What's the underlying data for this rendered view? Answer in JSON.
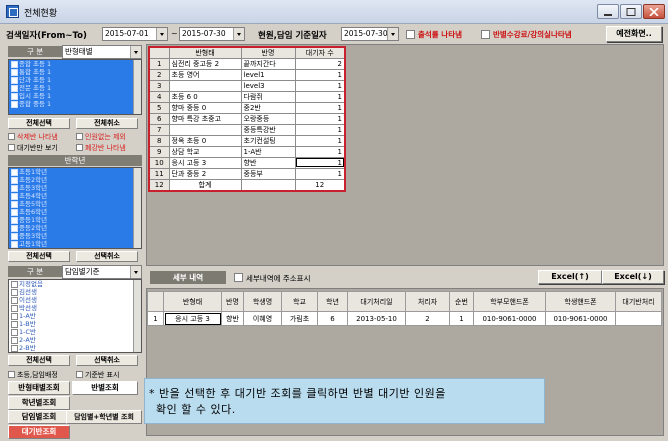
{
  "window": {
    "title": "전체현황"
  },
  "toolbar": {
    "search_date_label": "검색일자(From~To)",
    "date_from": "2015-07-01",
    "tilde": "~",
    "date_to": "2015-07-30",
    "class_base_label": "현원,담임 기준일자",
    "class_base_date": "2015-07-30",
    "chk_attendance_label": "출석률 나타냄",
    "chk_tuition_label": "반별수강료/강의실나타냄",
    "prev_screen_button": "예전화면.."
  },
  "left_panel": {
    "gubun1": "구 분",
    "form_select": "반형태별",
    "form_items": [
      "종합 초등 1",
      "통합 초등 1",
      "단과 초등 1",
      "전문 초등 1",
      "입시 초등 1",
      "종합 중등 1"
    ],
    "select_all": "전체선택",
    "clear_selection": "전체취소",
    "options": [
      {
        "label": "삭제반 나타냄",
        "red": true
      },
      {
        "label": "인원없는 제외",
        "red": true
      },
      {
        "label": "대기반만 보기",
        "red": false
      },
      {
        "label": "폐강반 나타냄",
        "red": true
      }
    ],
    "school_header": "반학년",
    "school_items": [
      "초등1학년",
      "초등2학년",
      "초등3학년",
      "초등4학년",
      "초등5학년",
      "초등6학년",
      "중등1학년",
      "중등2학년",
      "중등3학년",
      "고등1학년",
      "고등2학년",
      "고등3학년"
    ],
    "select_all_2": "전체선택",
    "clear_selection_2": "선택취소",
    "gubun2": "구 분",
    "teacher_select": "담임별기준",
    "teacher_items": [
      "지정없음",
      "김선생",
      "이선생",
      "박선생",
      "1-A반",
      "1-B반",
      "1-C반",
      "2-A반",
      "2-B반"
    ],
    "select_all_3": "전체선택",
    "clear_selection_3": "선택취소",
    "opt_grade": "초등,담임배정",
    "opt_base": "기준반 표시",
    "tab_form": "반형태별조회",
    "tab_class": "반별조회",
    "tab_grade": "학년별조회",
    "tab_teacher": "담임별조회",
    "tab_teacher_grade": "담임별+학년별 조회",
    "tab_waiting": "대기반조회"
  },
  "summary_table": {
    "headers": [
      "",
      "반형태",
      "반명",
      "대기자 수"
    ],
    "rows": [
      [
        "1",
        "심전리 중고등 2",
        "끝까지간다",
        "2"
      ],
      [
        "2",
        "초등 영어",
        "level1",
        "1"
      ],
      [
        "3",
        "",
        "level3",
        "1"
      ],
      [
        "4",
        "초등 6 0",
        "다람쥐",
        "1"
      ],
      [
        "5",
        "향마 중등 0",
        "중2반",
        "1"
      ],
      [
        "6",
        "향마 특강 초중고",
        "오랑중등",
        "1"
      ],
      [
        "7",
        "",
        "중등특강반",
        "1"
      ],
      [
        "8",
        "정옥 초등 0",
        "초기컨설팅",
        "1"
      ],
      [
        "9",
        "상담 학교",
        "1-A반",
        "1"
      ],
      [
        "10",
        "응시 고등 3",
        "향반",
        "1"
      ],
      [
        "11",
        "단과 중등 2",
        "중등부",
        "1"
      ],
      [
        "12",
        "합계",
        "",
        "12"
      ]
    ]
  },
  "detail_bar": {
    "detail_button": "세부 내역",
    "address_label": "세부내역에 주소표시",
    "excel_up": "Excel(↑)",
    "excel_down": "Excel(↓)"
  },
  "detail_table": {
    "headers": [
      "",
      "반형태",
      "반명",
      "학생명",
      "학교",
      "학년",
      "대기처리일",
      "처리자",
      "순번",
      "학부모핸드폰",
      "학생핸드폰",
      "대기반처리"
    ],
    "rows": [
      [
        "1",
        "응시 고등 3",
        "향반",
        "이혜영",
        "가림초",
        "6",
        "2013-05-10",
        "2",
        "1",
        "010-9061-0000",
        "010-9061-0000",
        ""
      ]
    ]
  },
  "note": {
    "line1": "* 반을 선택한 후 대기반 조회를 클릭하면 반별 대기반 인원을",
    "line2": "확인 할 수 있다."
  }
}
